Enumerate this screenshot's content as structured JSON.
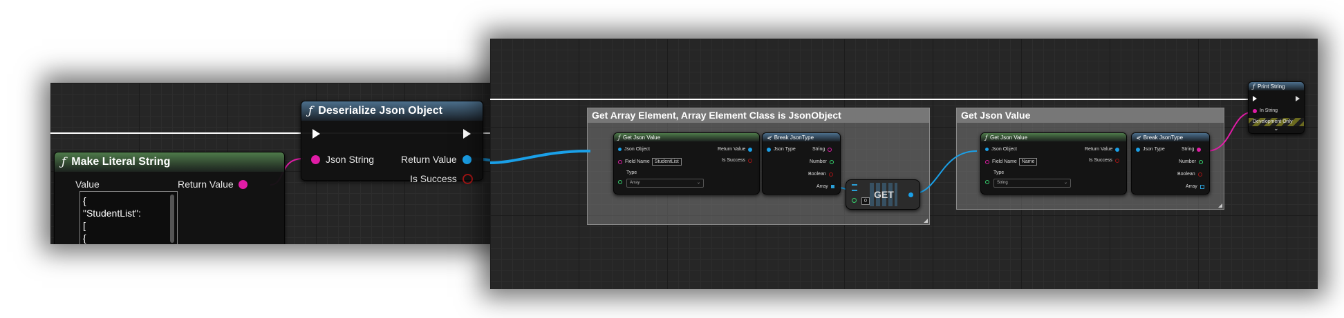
{
  "panel1": {
    "make_literal": {
      "title": "Make Literal String",
      "value_label": "Value",
      "return_label": "Return Value",
      "text_lines": [
        "{",
        " \"StudentList\":",
        " [",
        "  {"
      ]
    },
    "deserialize": {
      "title": "Deserialize Json Object",
      "json_string": "Json String",
      "return_value": "Return Value",
      "is_success": "Is Success"
    }
  },
  "panel2": {
    "comment1": "Get Array Element, Array Element Class is JsonObject",
    "comment2": "Get Json Value",
    "gjv1": {
      "title": "Get Json Value",
      "json_object": "Json Object",
      "return_value": "Return Value",
      "field_name_label": "Field Name",
      "field_name_value": "StudentList",
      "is_success": "Is Success",
      "type_label": "Type",
      "type_value": "Array"
    },
    "break1": {
      "title": "Break JsonType",
      "json_type": "Json Type",
      "string": "String",
      "number": "Number",
      "boolean": "Boolean",
      "array": "Array"
    },
    "get_node": {
      "title": "GET",
      "index": "0"
    },
    "gjv2": {
      "title": "Get Json Value",
      "json_object": "Json Object",
      "return_value": "Return Value",
      "field_name_label": "Field Name",
      "field_name_value": "Name",
      "is_success": "Is Success",
      "type_label": "Type",
      "type_value": "String"
    },
    "break2": {
      "title": "Break JsonType",
      "json_type": "Json Type",
      "string": "String",
      "number": "Number",
      "boolean": "Boolean",
      "array": "Array"
    },
    "print_string": {
      "title": "Print String",
      "in_string": "In String",
      "dev_only": "Development Only"
    }
  },
  "colors": {
    "wire_blue": "#1aa0e8",
    "wire_pink": "#e01ca6",
    "pin_green": "#36d46f",
    "pin_red": "#a11414",
    "pin_cyan": "#2aa0d8",
    "exec": "#ffffff"
  }
}
